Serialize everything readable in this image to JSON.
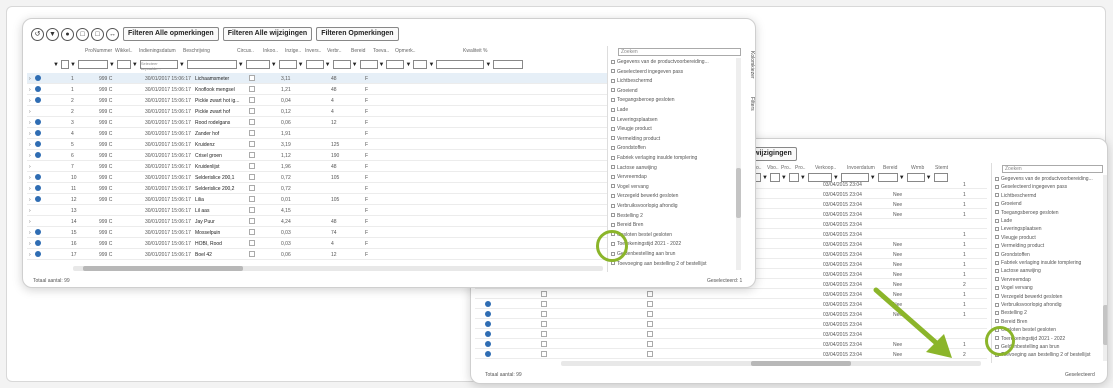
{
  "toolbar": {
    "round_icons": [
      "↺",
      "▼",
      "●",
      "□",
      "□",
      "↔"
    ],
    "buttons": [
      "Filteren Alle opmerkingen",
      "Filteren Alle wijzigingen",
      "Filteren Opmerkingen"
    ]
  },
  "grid_left": {
    "headers": [
      "Pro",
      "Nummer",
      "Wikkel..",
      "Indieningsdatum",
      "Beschrijving",
      "Circus..",
      "Inkoo..",
      "Inzige..",
      "Invers..",
      "Verbr..",
      "Bereid",
      "Toeva..",
      "Opmerk..",
      "Kwaliteit %"
    ],
    "filter_placeholder": "Selecteer bepaalde...",
    "rows": [
      {
        "nr": "1",
        "art": "999 C",
        "date": "30/01/2017 15:06:17",
        "desc": "Lichaamsmeter",
        "val": "3,11",
        "qty": "48",
        "sel": true
      },
      {
        "nr": "1",
        "art": "999 C",
        "date": "30/01/2017 15:06:17",
        "desc": "Knoflook mengsel",
        "val": "1,21",
        "qty": "48"
      },
      {
        "nr": "2",
        "art": "999 C",
        "date": "30/01/2017 15:06:17",
        "desc": "Pickle zwart hot ig...",
        "val": "0,04",
        "qty": "4"
      },
      {
        "nr": "2",
        "art": "999 C",
        "date": "30/01/2017 15:06:17",
        "desc": "Pickle zwart hof",
        "val": "0,12",
        "qty": "4"
      },
      {
        "nr": "3",
        "art": "999 C",
        "date": "30/01/2017 15:06:17",
        "desc": "Rood rodelgans",
        "val": "0,06",
        "qty": "12"
      },
      {
        "nr": "4",
        "art": "999 C",
        "date": "30/01/2017 15:06:17",
        "desc": "Zander hof",
        "val": "1,91",
        "qty": ""
      },
      {
        "nr": "5",
        "art": "999 C",
        "date": "30/01/2017 15:06:17",
        "desc": "Kruidenz",
        "val": "3,19",
        "qty": "125"
      },
      {
        "nr": "6",
        "art": "999 C",
        "date": "30/01/2017 15:06:17",
        "desc": "Crisel groen",
        "val": "1,12",
        "qty": "190"
      },
      {
        "nr": "7",
        "art": "999 C",
        "date": "30/01/2017 15:06:17",
        "desc": "Kruidenlijst",
        "val": "1,96",
        "qty": "48"
      },
      {
        "nr": "10",
        "art": "999 C",
        "date": "30/01/2017 15:06:17",
        "desc": "Selderislice 200,1",
        "val": "0,72",
        "qty": "105"
      },
      {
        "nr": "11",
        "art": "999 C",
        "date": "30/01/2017 15:06:17",
        "desc": "Selderislice 200,2",
        "val": "0,72",
        "qty": ""
      },
      {
        "nr": "12",
        "art": "999 C",
        "date": "30/01/2017 15:06:17",
        "desc": "Lilia",
        "val": "0,01",
        "qty": "105"
      },
      {
        "nr": "13",
        "art": "",
        "date": "30/01/2017 15:06:17",
        "desc": "Lil aas",
        "val": "4,15",
        "qty": ""
      },
      {
        "nr": "14",
        "art": "999 C",
        "date": "30/01/2017 15:06:17",
        "desc": "Jay Puur",
        "val": "4,24",
        "qty": "48"
      },
      {
        "nr": "15",
        "art": "999 C",
        "date": "30/01/2017 15:06:17",
        "desc": "Mosselpuin",
        "val": "0,03",
        "qty": "74"
      },
      {
        "nr": "16",
        "art": "999 C",
        "date": "30/01/2017 15:06:17",
        "desc": "HOBI, Rood",
        "val": "0,03",
        "qty": "4"
      },
      {
        "nr": "17",
        "art": "999 C",
        "date": "30/01/2017 15:06:17",
        "desc": "Boel 42",
        "val": "0,06",
        "qty": "12"
      }
    ],
    "footer_left": "Totaal aantal: 99",
    "footer_right": "Geselecteerd: 1"
  },
  "chooser_left": {
    "search_placeholder": "Zoeken",
    "side_tabs": [
      "Kolomkiezer",
      "Filters"
    ],
    "items": [
      "Gegevens van de productvoorbereiding...",
      "Geselecteerd ingegeven pass",
      "Lichtbeschermd",
      "Groeiend",
      "Toegangsberoep gesloten",
      "Lade",
      "Leveringsplaatsen",
      "Vleugje product",
      "Vermelding product",
      "Grondstoffen",
      "Fabriek verlaging insulde tomplering",
      "Lactose aanwijing",
      "Vervreemdap",
      "Vogel vervang",
      "Verzegeld bewerkt gesloten",
      "Verbruiksvoorlopig afrondig",
      "Bestelling 2",
      "Bereid Bren",
      "Gesloten bestel gesloten",
      "Toerekeningstijd 2021 - 2022",
      "Geldenbestelling aan brun",
      "Toevoeging aan bestelling 2 of bestellijst"
    ]
  },
  "grid_right": {
    "toolbar_fragment": "wijzigingen",
    "headers": [
      "Pro..",
      "Vbo..",
      "Pro..",
      "Pro..",
      "Verkoop..",
      "Invoerdatum",
      "Bereid",
      "Wrmb",
      "Stemt"
    ],
    "rows": [
      {
        "date": "03/04/2015 23:04",
        "val": "",
        "cnt": "1"
      },
      {
        "date": "03/04/2015 23:04",
        "val": "Nee",
        "cnt": "1"
      },
      {
        "date": "03/04/2015 23:04",
        "val": "Nee",
        "cnt": "1"
      },
      {
        "date": "03/04/2015 23:04",
        "val": "Nee",
        "cnt": "1"
      },
      {
        "date": "03/04/2015 23:04",
        "val": "",
        "cnt": ""
      },
      {
        "date": "03/04/2015 23:04",
        "val": "",
        "cnt": "1"
      },
      {
        "date": "03/04/2015 23:04",
        "val": "Nee",
        "cnt": "1"
      },
      {
        "date": "03/04/2015 23:04",
        "val": "Nee",
        "cnt": "1"
      },
      {
        "date": "03/04/2015 23:04",
        "val": "Nee",
        "cnt": "1"
      },
      {
        "date": "03/04/2015 23:04",
        "val": "Nee",
        "cnt": "1"
      },
      {
        "date": "03/04/2015 23:04",
        "val": "Nee",
        "cnt": "2"
      },
      {
        "date": "03/04/2015 23:04",
        "val": "Nee",
        "cnt": "1"
      },
      {
        "date": "03/04/2015 23:04",
        "val": "Nee",
        "cnt": "1"
      },
      {
        "date": "03/04/2015 23:04",
        "val": "Nee",
        "cnt": "1"
      },
      {
        "date": "03/04/2015 23:04",
        "val": "",
        "cnt": ""
      },
      {
        "date": "03/04/2015 23:04",
        "val": "",
        "cnt": ""
      },
      {
        "date": "03/04/2015 23:04",
        "val": "Nee",
        "cnt": "1"
      },
      {
        "date": "03/04/2015 23:04",
        "val": "Nee",
        "cnt": "2"
      }
    ],
    "footer_left": "Totaal aantal: 99",
    "footer_right": "Geselecteerd"
  },
  "chooser_right": {
    "search_placeholder": "Zoeken",
    "items": [
      "Gegevens van de productvoorbereiding...",
      "Geselecteerd ingegeven pass",
      "Lichtbeschermd",
      "Groeiend",
      "Toegangsberoep gesloten",
      "Lade",
      "Leveringsplaatsen",
      "Vleugje product",
      "Vermelding product",
      "Grondstoffen",
      "Fabriek verlaging insulde tomplering",
      "Lactose aanwijing",
      "Vervreemdap",
      "Vogel vervang",
      "Verzegeld bewerkt gesloten",
      "Verbruiksvoorlopig afrondig",
      "Bestelling 2",
      "Bereid Bren",
      "Gesloten bestel gesloten",
      "Toerekeningstijd 2021 - 2022",
      "Geldenbestelling aan brun",
      "Toevoeging aan bestelling 2 of bestellijst"
    ]
  },
  "colors": {
    "highlight": "#8bb52a",
    "dot": "#2f6db3",
    "selected_row": "#e6eff7"
  }
}
